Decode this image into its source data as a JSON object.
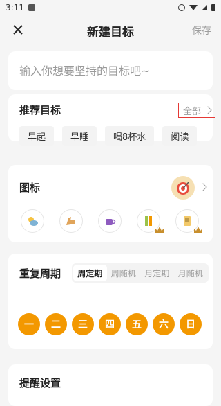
{
  "status_bar": {
    "time": "3:11"
  },
  "header": {
    "title": "新建目标",
    "save_label": "保存"
  },
  "goal_input": {
    "placeholder": "输入你想要坚持的目标吧~"
  },
  "recommend": {
    "title": "推荐目标",
    "all_label": "全部",
    "chips": [
      "早起",
      "早睡",
      "喝8杯水",
      "阅读"
    ]
  },
  "icon_section": {
    "title": "图标",
    "selected_icon": "target-icon",
    "options": [
      {
        "icon": "weather-icon",
        "premium": false
      },
      {
        "icon": "muscle-icon",
        "premium": false
      },
      {
        "icon": "cup-icon",
        "premium": false
      },
      {
        "icon": "ruler-pencil-icon",
        "premium": true
      },
      {
        "icon": "notebook-icon",
        "premium": true
      }
    ]
  },
  "cycle": {
    "title": "重复周期",
    "tabs": [
      "周定期",
      "周随机",
      "月定期",
      "月随机"
    ],
    "active_tab": "周定期",
    "days": [
      "一",
      "二",
      "三",
      "四",
      "五",
      "六",
      "日"
    ]
  },
  "reminder": {
    "title": "提醒设置"
  },
  "colors": {
    "accent": "#f39800",
    "highlight_border": "#e53935"
  }
}
